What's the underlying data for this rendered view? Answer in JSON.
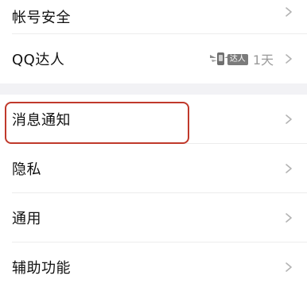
{
  "settings": {
    "group1": [
      {
        "label": "帐号安全"
      },
      {
        "label": "QQ达人",
        "badge": "达人",
        "days": "1天"
      }
    ],
    "group2": [
      {
        "label": "消息通知"
      },
      {
        "label": "隐私"
      },
      {
        "label": "通用"
      },
      {
        "label": "辅助功能"
      }
    ]
  },
  "highlight_color": "#c0392b"
}
